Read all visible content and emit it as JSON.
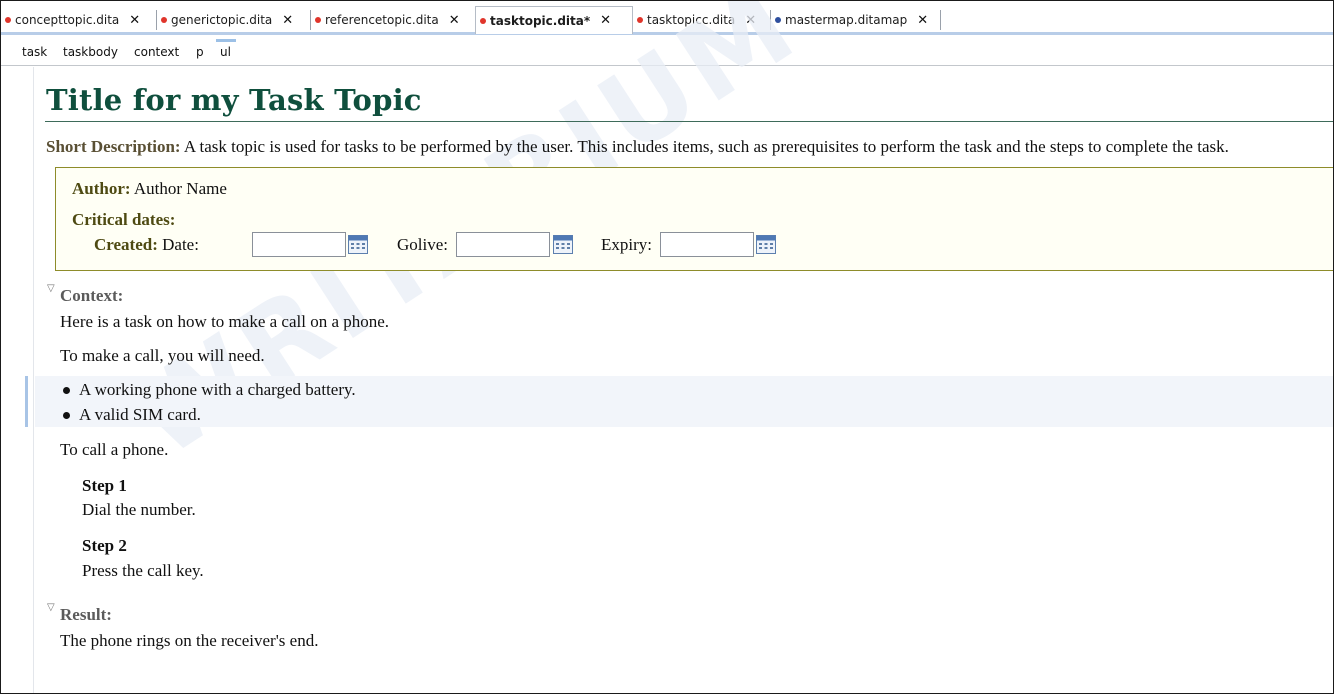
{
  "tabs": [
    {
      "label": "concepttopic.dita",
      "dot_color": "#e0352b",
      "active": false
    },
    {
      "label": "generictopic.dita",
      "dot_color": "#e0352b",
      "active": false
    },
    {
      "label": "referencetopic.dita",
      "dot_color": "#e0352b",
      "active": false
    },
    {
      "label": "tasktopic.dita*",
      "dot_color": "#e0352b",
      "active": true
    },
    {
      "label": "tasktopicc.dita",
      "dot_color": "#e0352b",
      "active": false
    },
    {
      "label": "mastermap.ditamap",
      "dot_color": "#2e4f9e",
      "active": false
    }
  ],
  "close_glyph": "✕",
  "breadcrumb": [
    "task",
    "taskbody",
    "context",
    "p",
    "ul"
  ],
  "document": {
    "title": "Title for my Task Topic",
    "short_description": {
      "label": "Short Description:",
      "text": "A task topic is used for tasks to be performed by the user. This includes items, such as prerequisites to perform the task and the steps to complete the task."
    },
    "prolog": {
      "author_label": "Author:",
      "author_value": "Author Name",
      "critical_dates_label": "Critical dates:",
      "created_label": "Created:",
      "date_label": "Date:",
      "golive_label": "Golive:",
      "expiry_label": "Expiry:",
      "created_value": "",
      "golive_value": "",
      "expiry_value": ""
    },
    "context": {
      "heading": "Context:",
      "paragraphs": [
        "Here is a task on how to make a call on a phone.",
        "To make a call, you will need."
      ],
      "list_items": [
        "A working phone with a charged battery.",
        "A valid SIM card."
      ],
      "after_list": "To call a phone."
    },
    "steps": [
      {
        "heading": "Step 1",
        "text": "Dial the number."
      },
      {
        "heading": "Step 2",
        "text": "Press the call key."
      }
    ],
    "result": {
      "heading": "Result:",
      "text": "The phone rings on the receiver's end."
    }
  },
  "watermark": "WRITARIUM",
  "colors": {
    "title": "#0f4f3d",
    "label": "#5a5035",
    "prolog_border": "#8e8c2a",
    "selection_bar": "#a8c4e6"
  }
}
